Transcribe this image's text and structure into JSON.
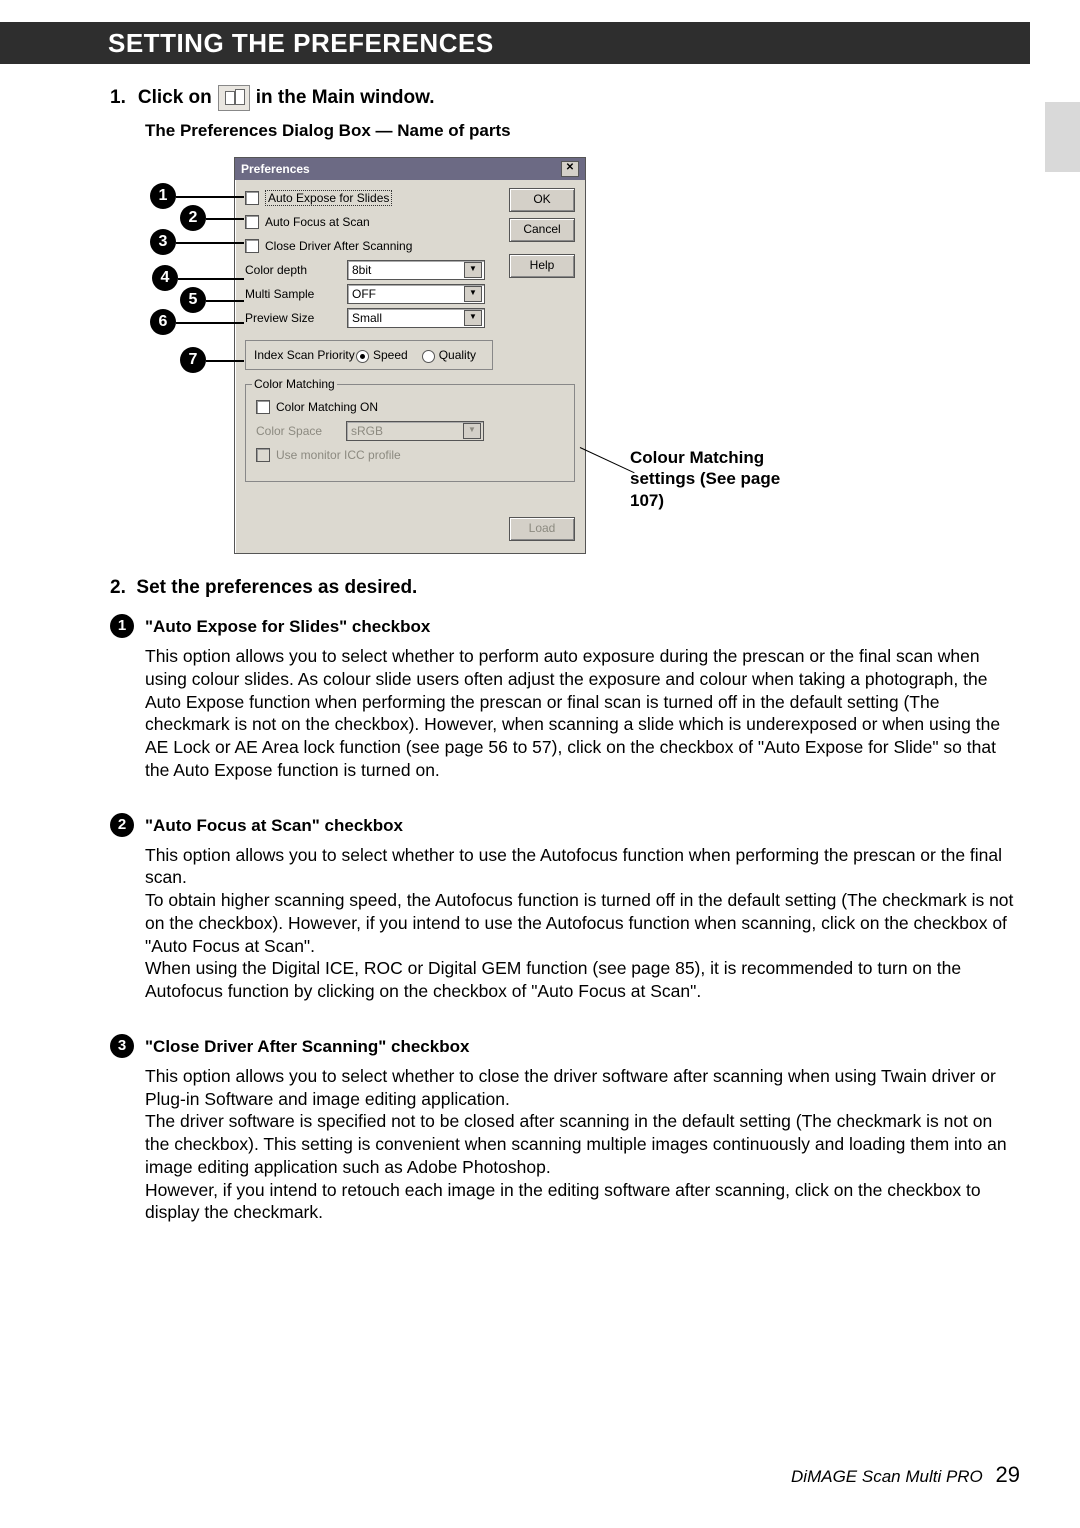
{
  "header": {
    "title": "SETTING THE PREFERENCES"
  },
  "step1": {
    "num": "1.",
    "pre": "Click on",
    "post": "in the Main window.",
    "sub": "The Preferences Dialog Box — Name of parts"
  },
  "dialog": {
    "title": "Preferences",
    "close_glyph": "✕",
    "btn_ok": "OK",
    "btn_cancel": "Cancel",
    "btn_help": "Help",
    "btn_load": "Load",
    "cb1": "Auto Expose for Slides",
    "cb2": "Auto Focus at Scan",
    "cb3": "Close Driver After Scanning",
    "row4_label": "Color depth",
    "row4_value": "8bit",
    "row5_label": "Multi Sample",
    "row5_value": "OFF",
    "row6_label": "Preview Size",
    "row6_value": "Small",
    "isp_label": "Index Scan Priority",
    "isp_opt1": "Speed",
    "isp_opt2": "Quality",
    "grp_title": "Color Matching",
    "grp_cb": "Color Matching ON",
    "grp_cs_label": "Color Space",
    "grp_cs_value": "sRGB",
    "grp_icc": "Use monitor ICC profile"
  },
  "callouts": {
    "c1": "1",
    "c2": "2",
    "c3": "3",
    "c4": "4",
    "c5": "5",
    "c6": "6",
    "c7": "7"
  },
  "side_note": "Colour Matching settings (See page 107)",
  "step2": {
    "num": "2.",
    "text": "Set the preferences as desired."
  },
  "b1": {
    "n": "1",
    "title": "\"Auto Expose for Slides\" checkbox",
    "body": "This option allows you to select whether to perform auto exposure during the prescan or the final scan when using colour slides. As colour slide users often adjust the exposure and colour when taking a photograph, the Auto Expose function when performing the prescan or final scan is turned off in the default setting (The checkmark is not on the checkbox). However, when scanning a slide which is underexposed or when using the AE Lock or AE Area lock function (see page 56 to 57), click on the checkbox of \"Auto Expose for Slide\" so that the Auto Expose function is turned on."
  },
  "b2": {
    "n": "2",
    "title": "\"Auto Focus at Scan\" checkbox",
    "body": "This option allows you to select whether to use the Autofocus function when performing the prescan or the final scan.\nTo obtain higher scanning speed, the Autofocus function is turned off in the default setting (The checkmark is not on the checkbox). However, if you intend to use the Autofocus function when scanning, click on the checkbox of \"Auto Focus at Scan\".\nWhen using the Digital ICE, ROC or Digital GEM function (see page 85), it is recommended to turn on the Autofocus function by clicking on the checkbox of \"Auto Focus at Scan\"."
  },
  "b3": {
    "n": "3",
    "title": "\"Close Driver After Scanning\" checkbox",
    "body": "This option allows you to select whether to close the driver software after scanning when using Twain driver or Plug-in Software and image editing application.\nThe driver software is specified not to be closed after scanning in the default setting (The checkmark is not on the checkbox). This setting is convenient when scanning multiple images continuously and loading them into an image editing application such as Adobe Photoshop.\nHowever, if you intend to retouch each image in the editing software after scanning, click on the checkbox to display the checkmark."
  },
  "footer": {
    "product": "DiMAGE Scan Multi PRO",
    "page": "29"
  }
}
